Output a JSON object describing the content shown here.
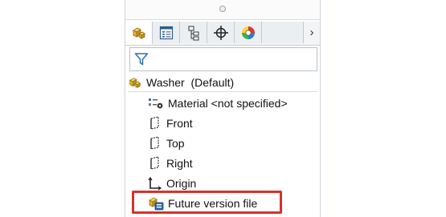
{
  "tabs": [
    {
      "icon": "part-icon",
      "active": true
    },
    {
      "icon": "property-manager-icon",
      "active": false
    },
    {
      "icon": "configuration-manager-icon",
      "active": false
    },
    {
      "icon": "dimxpert-icon",
      "active": false
    },
    {
      "icon": "display-manager-icon",
      "active": false
    }
  ],
  "tabs_more_glyph": "›",
  "filter": {
    "icon": "filter-icon"
  },
  "tree": {
    "root": {
      "label": "Washer  (Default)",
      "icon": "part-icon"
    },
    "items": [
      {
        "label": "Material <not specified>",
        "icon": "material-icon"
      },
      {
        "label": "Front",
        "icon": "plane-icon"
      },
      {
        "label": "Top",
        "icon": "plane-icon"
      },
      {
        "label": "Right",
        "icon": "plane-icon"
      },
      {
        "label": "Origin",
        "icon": "origin-icon"
      },
      {
        "label": "Future version file",
        "icon": "future-version-icon",
        "highlighted": true
      }
    ]
  },
  "colors": {
    "highlight": "#d9302b",
    "part_icon": "#e8b22e"
  }
}
